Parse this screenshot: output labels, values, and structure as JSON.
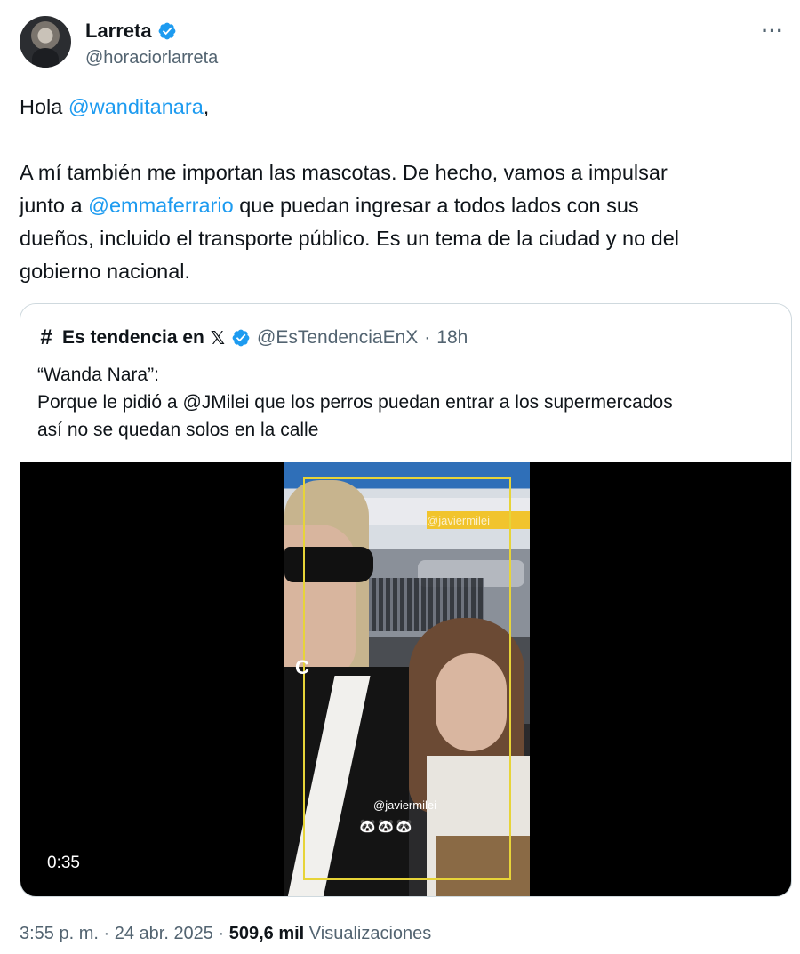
{
  "author": {
    "name": "Larreta",
    "handle": "@horaciorlarreta",
    "verified": true,
    "avatar_icon": "avatar-photo"
  },
  "more_label": "···",
  "tweet": {
    "line1_prefix": "Hola ",
    "line1_mention": "@wanditanara",
    "line1_suffix": ",",
    "p2_line1": "A mí también me importan  las mascotas. De hecho, vamos a impulsar",
    "p2_line2_prefix": "junto a ",
    "p2_line2_mention": "@emmaferrario",
    "p2_line2_suffix": " que puedan ingresar a todos lados con sus",
    "p2_line3": "dueños, incluido el transporte público. Es un tema de la ciudad y no del",
    "p2_line4": "gobierno nacional."
  },
  "quote": {
    "icon": "#",
    "name": "Es tendencia en",
    "x_glyph": "𝕏",
    "handle": "@EsTendenciaEnX",
    "separator": "·",
    "time": "18h",
    "line1": "“Wanda Nara”:",
    "line2": "Porque le pidió a @JMilei que los perros puedan entrar a los supermercados",
    "line3": "así no se quedan solos en la calle",
    "video": {
      "duration": "0:35",
      "watermark_top": "@javiermilei",
      "watermark_c": "C",
      "watermark_handle": "@javiermilei",
      "emoji": "🐼🐼🐼"
    }
  },
  "meta": {
    "time": "3:55 p. m.",
    "sep1": " · ",
    "date": "24 abr. 2025",
    "sep2": " · ",
    "views": "509,6 mil",
    "views_label": " Visualizaciones"
  },
  "colors": {
    "link": "#1d9bf0",
    "verified": "#1d9bf0",
    "secondary": "#536471",
    "border": "#cfd9de"
  }
}
